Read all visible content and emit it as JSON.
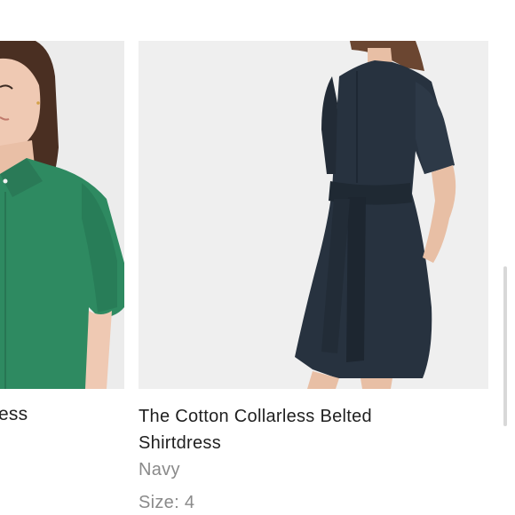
{
  "products": [
    {
      "name_partial": "ess",
      "garment_color_hex": "#2e8a61"
    },
    {
      "name": "The Cotton Collarless Belted Shirtdress",
      "color": "Navy",
      "size": "Size: 4",
      "garment_color_hex": "#27323f"
    }
  ],
  "colors": {
    "title_text": "#1f1f1f",
    "muted_text": "#8a8a8a",
    "image_bg": "#efefef"
  }
}
